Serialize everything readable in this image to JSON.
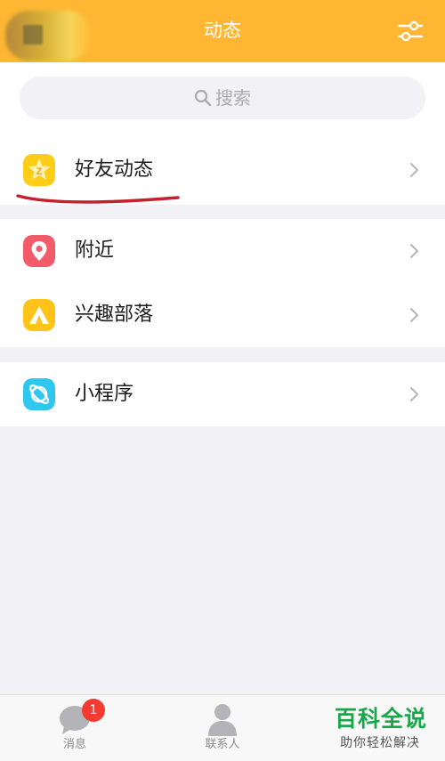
{
  "header": {
    "title": "动态",
    "settings_icon": "sliders-icon",
    "color": "#ffb733"
  },
  "search": {
    "placeholder": "搜索",
    "icon": "search-icon"
  },
  "groups": [
    {
      "items": [
        {
          "label": "好友动态",
          "icon": "qzone-star-icon",
          "icon_color": "#ffcc18"
        }
      ]
    },
    {
      "items": [
        {
          "label": "附近",
          "icon": "location-pin-icon",
          "icon_color": "#f25b6a"
        },
        {
          "label": "兴趣部落",
          "icon": "tent-icon",
          "icon_color": "#ffc319"
        }
      ]
    },
    {
      "items": [
        {
          "label": "小程序",
          "icon": "planet-icon",
          "icon_color": "#2fc7ed"
        }
      ]
    }
  ],
  "tabbar": {
    "tabs": [
      {
        "label": "消息",
        "icon": "chat-bubble-icon",
        "badge": "1"
      },
      {
        "label": "联系人",
        "icon": "contact-person-icon"
      }
    ]
  },
  "watermark": {
    "main": "百科全说",
    "sub": "助你轻松解决"
  },
  "colors": {
    "badge": "#f43b32",
    "watermark": "#1aa64b",
    "annotation_underline": "#c4202e"
  }
}
